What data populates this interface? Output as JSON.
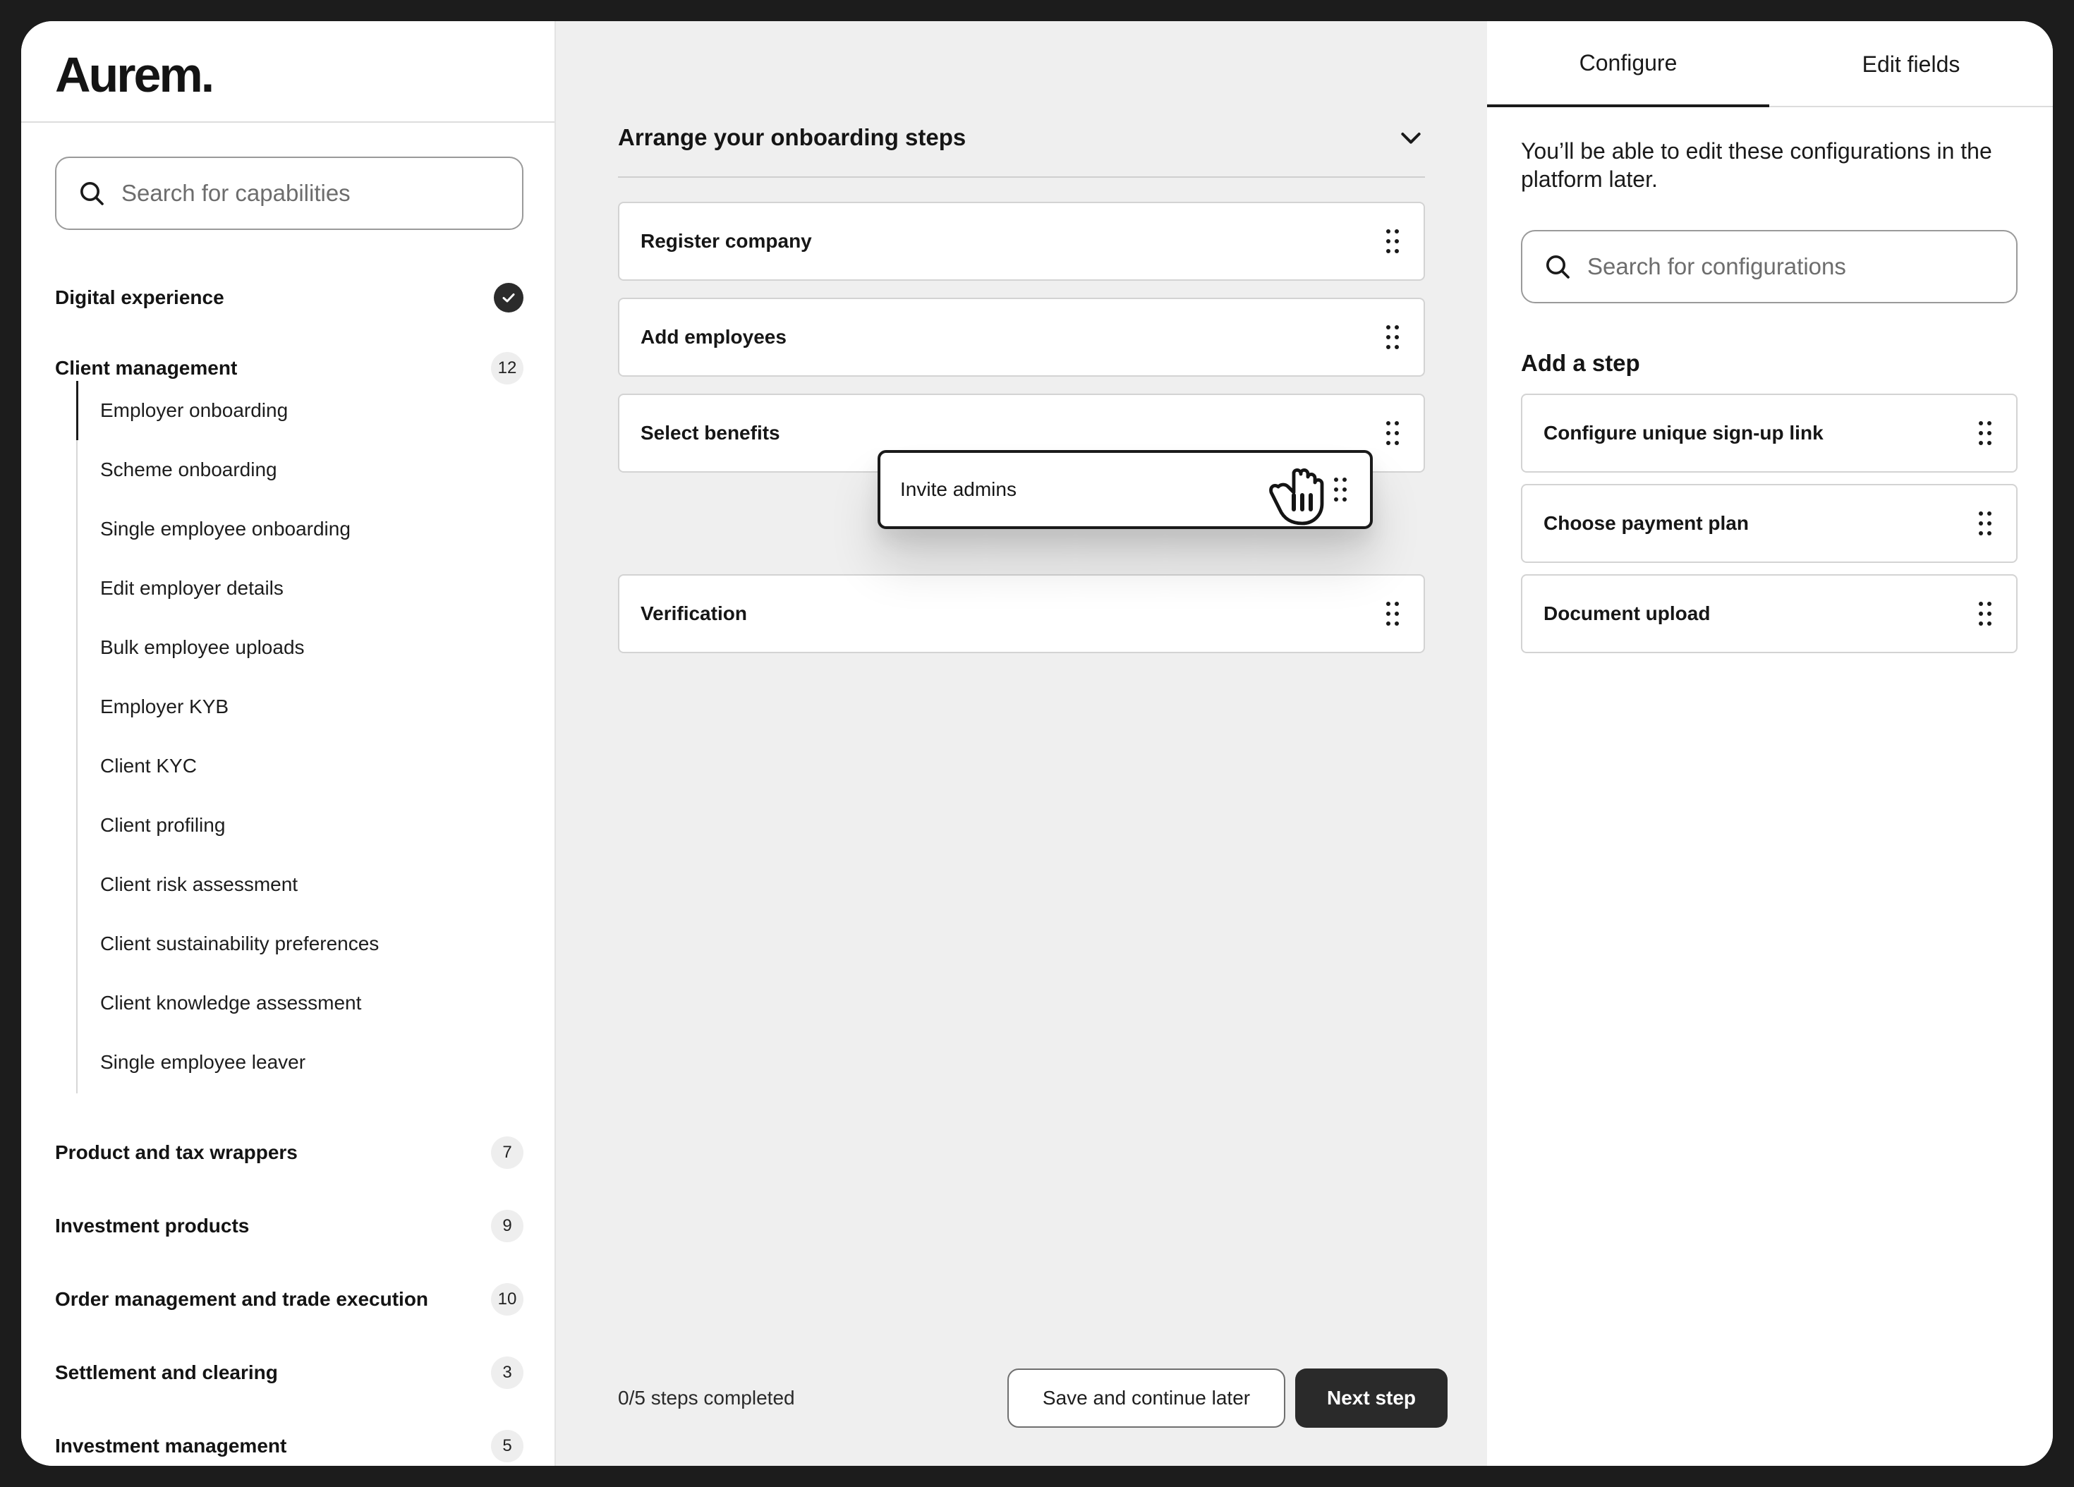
{
  "app": {
    "logo": "Aurem."
  },
  "sidebar": {
    "search_placeholder": "Search for capabilities",
    "categories": [
      {
        "label": "Digital experience",
        "status": "completed"
      },
      {
        "label": "Client management",
        "count": "12"
      },
      {
        "label": "Product and tax wrappers",
        "count": "7"
      },
      {
        "label": "Investment products",
        "count": "9"
      },
      {
        "label": "Order management and trade execution",
        "count": "10"
      },
      {
        "label": "Settlement and clearing",
        "count": "3"
      },
      {
        "label": "Investment management",
        "count": "5"
      }
    ],
    "client_management_items": [
      "Employer onboarding",
      "Scheme onboarding",
      "Single employee onboarding",
      "Edit employer details",
      "Bulk employee uploads",
      "Employer KYB",
      "Client KYC",
      "Client profiling",
      "Client risk assessment",
      "Client sustainability preferences",
      "Client knowledge assessment",
      "Single employee leaver"
    ],
    "active_item": "Employer onboarding"
  },
  "main": {
    "title": "Arrange your onboarding steps",
    "steps": [
      "Register company",
      "Add employees",
      "Select benefits",
      "Verification"
    ],
    "dragging_step": "Invite admins",
    "progress": "0/5 steps completed",
    "save_label": "Save and continue later",
    "next_label": "Next step"
  },
  "panel": {
    "tabs": [
      "Configure",
      "Edit fields"
    ],
    "active_tab": "Configure",
    "description": "You’ll be able to edit these configurations in the platform later.",
    "search_placeholder": "Search for configurations",
    "add_step_title": "Add a step",
    "available_steps": [
      "Configure unique sign-up link",
      "Choose payment plan",
      "Document upload"
    ]
  },
  "colors": {
    "primary": "#2a2a2a",
    "canvas_bg": "#efefef",
    "surface": "#ffffff",
    "border": "#d3d3d3"
  },
  "icons": [
    "search-icon",
    "check-icon",
    "chevron-down-icon",
    "drag-handle-icon",
    "grab-hand-cursor-icon"
  ]
}
